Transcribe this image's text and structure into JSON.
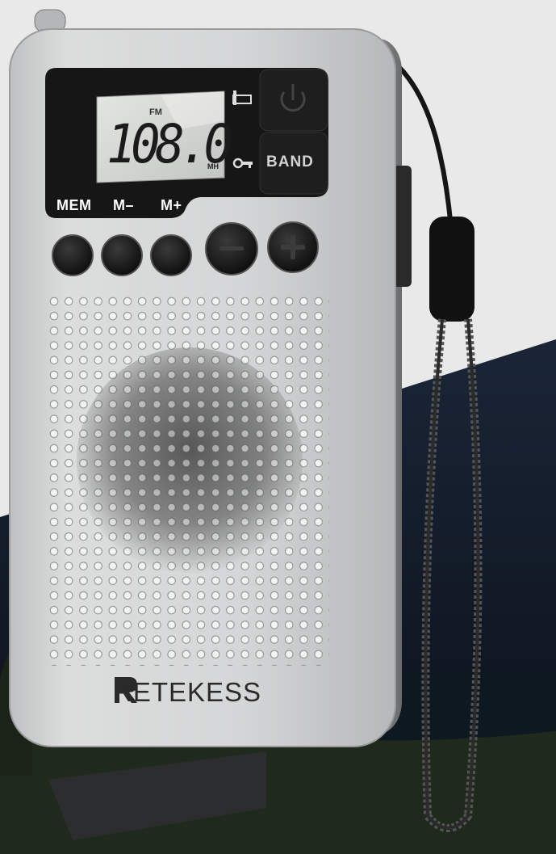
{
  "display": {
    "band": "FM",
    "frequency": "108.0",
    "unit": "MH"
  },
  "buttons": {
    "mem_label": "MEM",
    "m_minus_label": "M–",
    "m_plus_label": "M+",
    "band_label": "BAND"
  },
  "brand": {
    "name": "RETEKESS"
  },
  "colors": {
    "body_silver": "#d4d5d6",
    "lcd_background": "#cfd1ce",
    "button_black": "#141414",
    "night_sky": "#0d1420"
  }
}
